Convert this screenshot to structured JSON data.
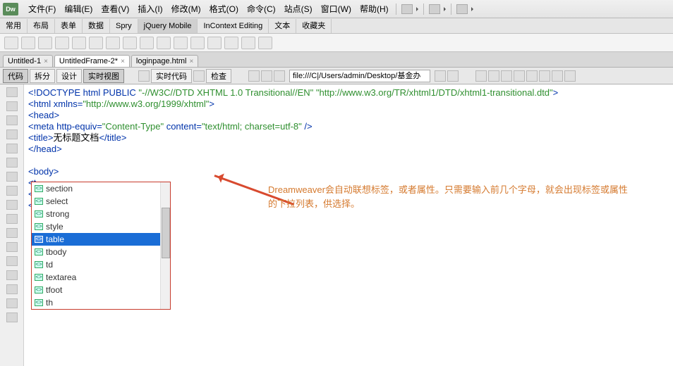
{
  "app": {
    "logo": "Dw"
  },
  "menu": {
    "items": [
      "文件(F)",
      "编辑(E)",
      "查看(V)",
      "插入(I)",
      "修改(M)",
      "格式(O)",
      "命令(C)",
      "站点(S)",
      "窗口(W)",
      "帮助(H)"
    ]
  },
  "insert_tabs": {
    "items": [
      "常用",
      "布局",
      "表单",
      "数据",
      "Spry",
      "jQuery Mobile",
      "InContext Editing",
      "文本",
      "收藏夹"
    ],
    "active_index": 5
  },
  "doc_tabs": {
    "items": [
      "Untitled-1",
      "UntitledFrame-2*",
      "loginpage.html"
    ],
    "active_index": 1
  },
  "view_bar": {
    "buttons": [
      "代码",
      "拆分",
      "设计",
      "实时视图"
    ],
    "extra": [
      "实时代码",
      "检查"
    ],
    "address": "file:///C|/Users/admin/Desktop/基金办"
  },
  "code": {
    "l1_a": "<!DOCTYPE html PUBLIC ",
    "l1_b": "\"-//W3C//DTD XHTML 1.0 Transitional//EN\" \"http://www.w3.org/TR/xhtml1/DTD/xhtml1-transitional.dtd\"",
    "l1_c": ">",
    "l2_a": "<html xmlns=",
    "l2_b": "\"http://www.w3.org/1999/xhtml\"",
    "l2_c": ">",
    "l3": "<head>",
    "l4_a": "<meta http-equiv=",
    "l4_b": "\"Content-Type\"",
    "l4_c": " content=",
    "l4_d": "\"text/html; charset=utf-8\"",
    "l4_e": " />",
    "l5_a": "<title>",
    "l5_b": "无标题文档",
    "l5_c": "</title>",
    "l6": "</head>",
    "l7": "",
    "l8": "<body>",
    "l9": "<t",
    "l10": "</",
    "l11": "</"
  },
  "autocomplete": {
    "items": [
      "section",
      "select",
      "strong",
      "style",
      "table",
      "tbody",
      "td",
      "textarea",
      "tfoot",
      "th"
    ],
    "selected_index": 4
  },
  "annotation": {
    "text": "Dreamweaver会自动联想标签，或者属性。只需要输入前几个字母，就会出现标签或属性的下拉列表，供选择。"
  }
}
